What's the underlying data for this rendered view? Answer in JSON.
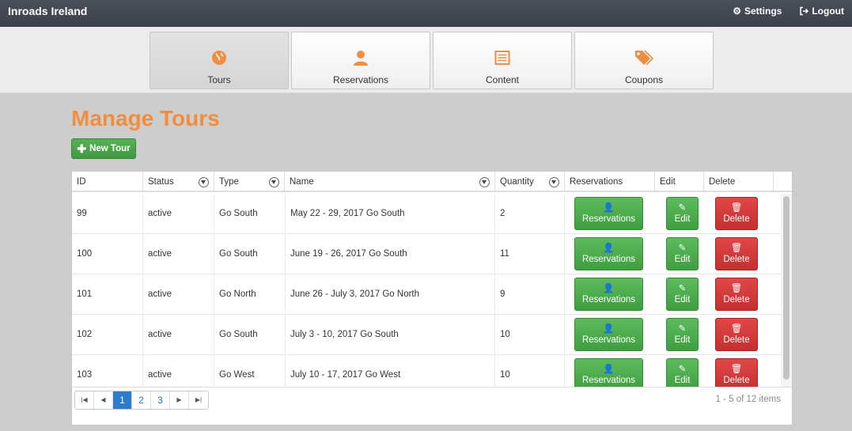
{
  "app": {
    "title": "Inroads Ireland",
    "nav": {
      "settings": "Settings",
      "logout": "Logout"
    }
  },
  "tiles": [
    {
      "label": "Tours",
      "icon": "globe-icon",
      "active": true
    },
    {
      "label": "Reservations",
      "icon": "user-icon",
      "active": false
    },
    {
      "label": "Content",
      "icon": "list-icon",
      "active": false
    },
    {
      "label": "Coupons",
      "icon": "tags-icon",
      "active": false
    }
  ],
  "page": {
    "title": "Manage Tours",
    "new_button": "New Tour"
  },
  "table": {
    "columns": [
      "ID",
      "Status",
      "Type",
      "Name",
      "Quantity",
      "Reservations",
      "Edit",
      "Delete"
    ],
    "rows": [
      {
        "id": "99",
        "status": "active",
        "type": "Go South",
        "name": "May 22 - 29, 2017 Go South",
        "quantity": "2"
      },
      {
        "id": "100",
        "status": "active",
        "type": "Go South",
        "name": "June 19 - 26, 2017 Go South",
        "quantity": "11"
      },
      {
        "id": "101",
        "status": "active",
        "type": "Go North",
        "name": "June 26 - July 3, 2017 Go North",
        "quantity": "9"
      },
      {
        "id": "102",
        "status": "active",
        "type": "Go South",
        "name": "July 3 - 10, 2017 Go South",
        "quantity": "10"
      },
      {
        "id": "103",
        "status": "active",
        "type": "Go West",
        "name": "July 10 - 17, 2017 Go West",
        "quantity": "10"
      }
    ],
    "actions": {
      "reservations": "Reservations",
      "edit": "Edit",
      "delete": "Delete"
    }
  },
  "pager": {
    "pages": [
      "1",
      "2",
      "3"
    ],
    "current": "1",
    "info": "1 - 5 of 12 items"
  },
  "colors": {
    "accent": "#f08d3f",
    "topbar": "#41454e",
    "success": "#4cae4c",
    "danger": "#d9534f",
    "pager_active": "#2d7bcf"
  }
}
